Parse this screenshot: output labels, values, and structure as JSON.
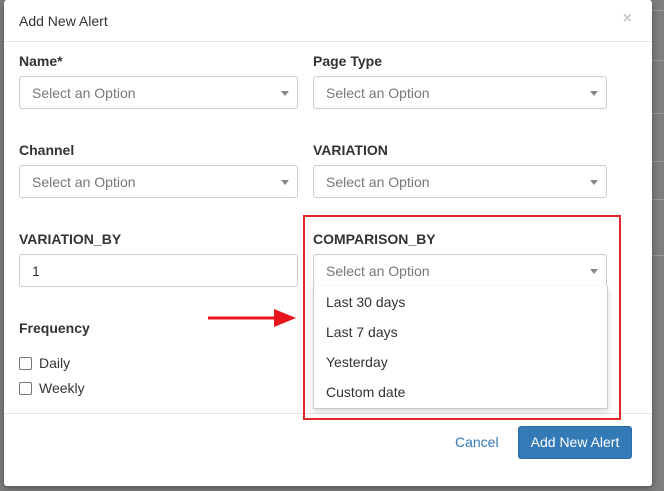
{
  "modal": {
    "title": "Add New Alert",
    "close_glyph": "×"
  },
  "fields": {
    "name": {
      "label": "Name*",
      "placeholder": "Select an Option"
    },
    "page_type": {
      "label": "Page Type",
      "placeholder": "Select an Option"
    },
    "channel": {
      "label": "Channel",
      "placeholder": "Select an Option"
    },
    "variation": {
      "label": "VARIATION",
      "placeholder": "Select an Option"
    },
    "variation_by": {
      "label": "VARIATION_BY",
      "value": "1"
    },
    "comparison_by": {
      "label": "COMPARISON_BY",
      "placeholder": "Select an Option",
      "options": [
        "Last 30 days",
        "Last 7 days",
        "Yesterday",
        "Custom date"
      ]
    },
    "frequency": {
      "label": "Frequency",
      "options": [
        "Daily",
        "Weekly"
      ]
    }
  },
  "footer": {
    "cancel_label": "Cancel",
    "submit_label": "Add New Alert"
  },
  "colors": {
    "primary": "#337ab7",
    "highlight": "#e0272b",
    "arrow": "#e8141c"
  },
  "icons": {
    "close": "close-icon",
    "caret": "chevron-down-icon",
    "arrow": "arrow-right-icon"
  }
}
